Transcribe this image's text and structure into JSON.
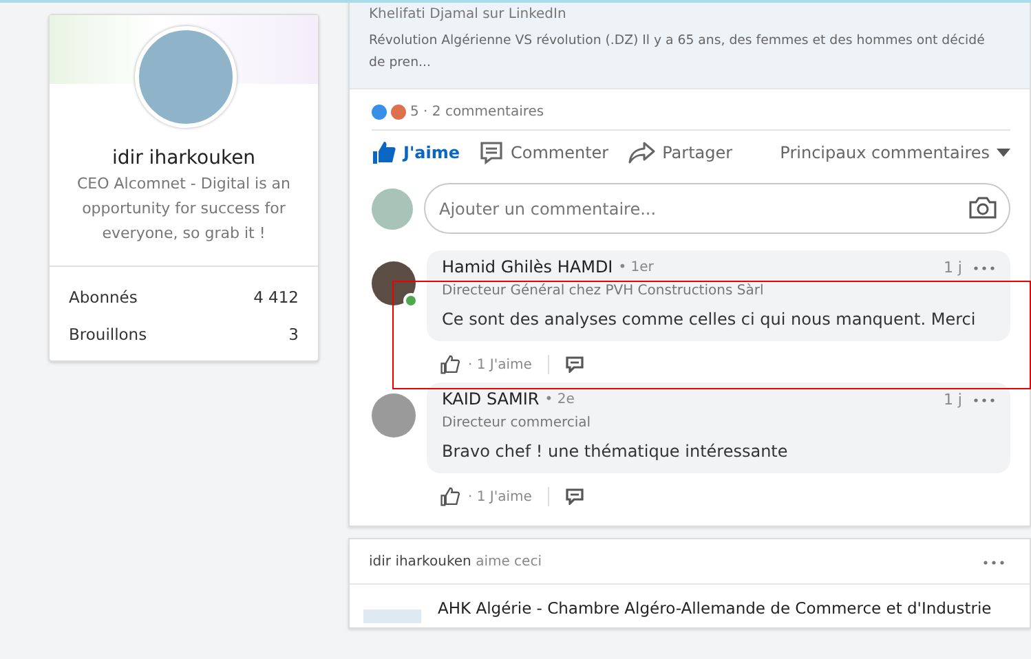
{
  "profile": {
    "name": "idir iharkouken",
    "headline": "CEO Alcomnet - Digital is an opportunity for success for everyone, so grab it !",
    "stats": [
      {
        "label": "Abonnés",
        "value": "4 412"
      },
      {
        "label": "Brouillons",
        "value": "3"
      }
    ]
  },
  "post": {
    "shared_by": "Khelifati Djamal sur LinkedIn",
    "excerpt": "Révolution Algérienne VS révolution (.DZ) Il y a 65 ans, des femmes et des hommes ont décidé de pren...",
    "reactions": "5 · 2 commentaires",
    "actions": [
      {
        "kind": "like",
        "label": "J'aime",
        "selected": true
      },
      {
        "kind": "comment",
        "label": "Commenter",
        "selected": false
      },
      {
        "kind": "share",
        "label": "Partager",
        "selected": false
      }
    ],
    "sort": "Principaux commentaires",
    "comment_field": {
      "placeholder": "Ajouter un commentaire..."
    },
    "comments": [
      {
        "author": "Hamid Ghilès HAMDI",
        "degree": "• 1er",
        "headline": "Directeur Général chez PVH Constructions Sàrl",
        "text": "Ce sont des analyses comme celles ci qui nous manquent. Merci",
        "time": "1 j",
        "likes": "· 1 J'aime",
        "online": true
      },
      {
        "author": "KAID SAMIR",
        "degree": "• 2e",
        "headline": "Directeur commercial",
        "text": "Bravo chef ! une thématique intéressante",
        "time": "1 j",
        "likes": "· 1 J'aime",
        "online": false
      }
    ]
  },
  "activity": {
    "actor": "idir iharkouken",
    "verb": "aime ceci",
    "company": "AHK Algérie - Chambre Algéro-Allemande de Commerce et d'Industrie"
  },
  "annotation": {
    "shown": true
  }
}
